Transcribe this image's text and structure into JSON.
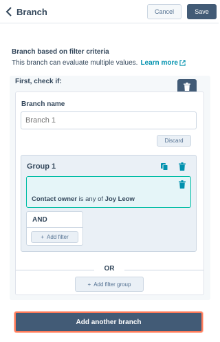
{
  "header": {
    "title": "Branch",
    "cancel_label": "Cancel",
    "save_label": "Save"
  },
  "intro": {
    "title": "Branch based on filter criteria",
    "description": "This branch can evaluate multiple values.",
    "learn_more": "Learn more"
  },
  "panel": {
    "first_check": "First, check if:",
    "branch_name_label": "Branch name",
    "branch_name_placeholder": "Branch 1",
    "discard_label": "Discard",
    "group": {
      "title": "Group 1",
      "filter": {
        "property": "Contact owner",
        "operator": "is any of",
        "value": "Joy Leow"
      },
      "and_label": "AND",
      "add_filter_label": "Add filter"
    },
    "or_label": "OR",
    "add_filter_group_label": "Add filter group"
  },
  "add_branch_label": "Add another branch",
  "colors": {
    "accent_dark": "#425b76",
    "link": "#0091ae",
    "filter_border": "#00bda5",
    "focus_ring": "#ff7a59"
  }
}
